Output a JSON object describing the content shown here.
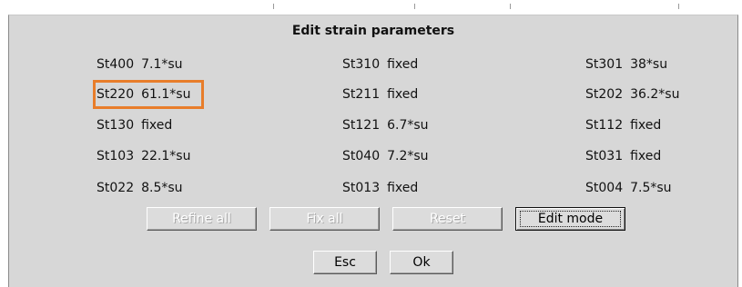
{
  "dialog": {
    "title": "Edit strain parameters"
  },
  "rows": [
    [
      {
        "name": "St400",
        "value": "7.1*su"
      },
      {
        "name": "St310",
        "value": "fixed"
      },
      {
        "name": "St301",
        "value": "38*su"
      }
    ],
    [
      {
        "name": "St220",
        "value": "61.1*su"
      },
      {
        "name": "St211",
        "value": "fixed"
      },
      {
        "name": "St202",
        "value": "36.2*su"
      }
    ],
    [
      {
        "name": "St130",
        "value": "fixed"
      },
      {
        "name": "St121",
        "value": "6.7*su"
      },
      {
        "name": "St112",
        "value": "fixed"
      }
    ],
    [
      {
        "name": "St103",
        "value": "22.1*su"
      },
      {
        "name": "St040",
        "value": "7.2*su"
      },
      {
        "name": "St031",
        "value": "fixed"
      }
    ],
    [
      {
        "name": "St022",
        "value": "8.5*su"
      },
      {
        "name": "St013",
        "value": "fixed"
      },
      {
        "name": "St004",
        "value": "7.5*su"
      }
    ]
  ],
  "highlighted": "St220",
  "highlight_color": "#e87d2a",
  "buttons": {
    "refine_all": "Refine all",
    "fix_all": "Fix all",
    "reset": "Reset",
    "edit_mode": "Edit mode",
    "esc": "Esc",
    "ok": "Ok"
  }
}
